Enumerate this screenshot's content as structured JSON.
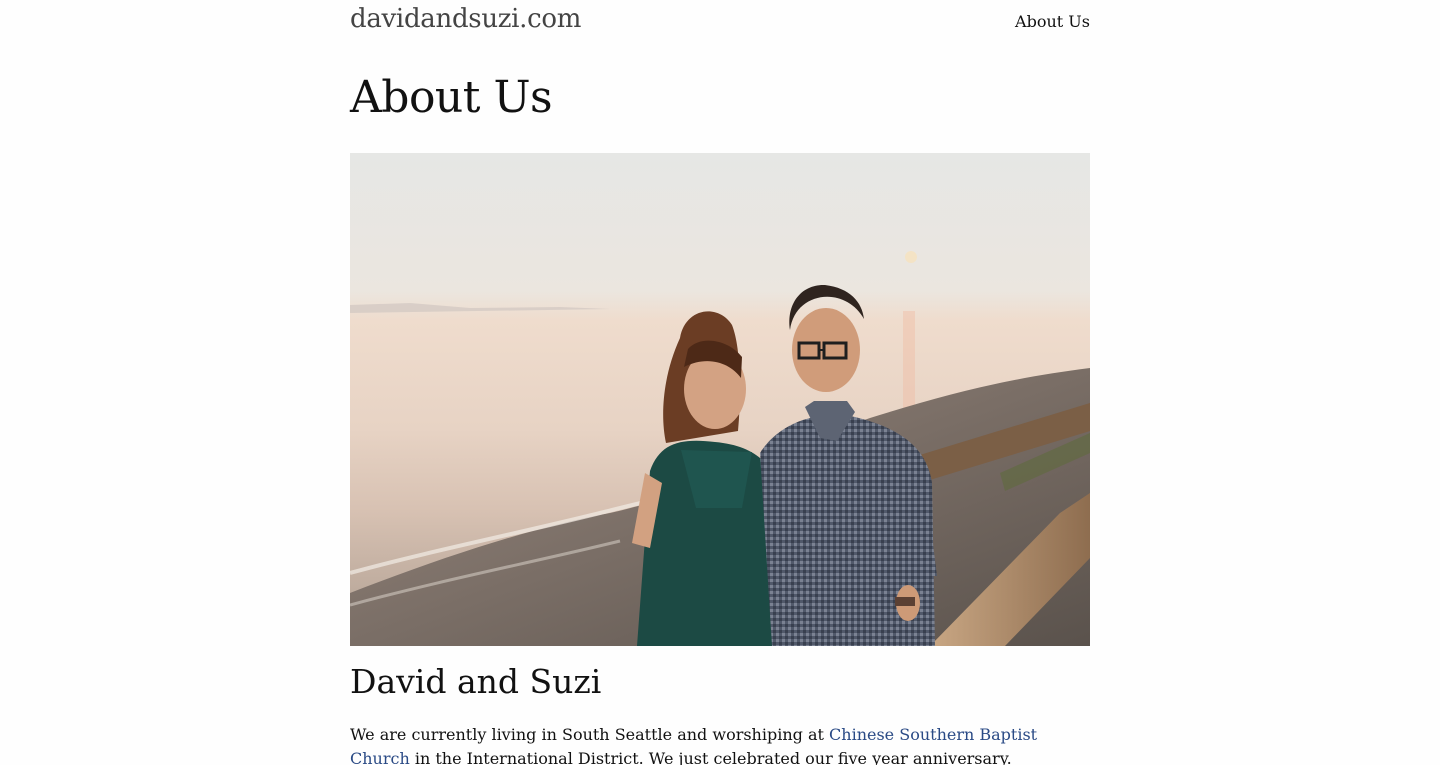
{
  "site": {
    "title": "davidandsuzi.com"
  },
  "nav": {
    "items": [
      {
        "label": "About Us"
      }
    ]
  },
  "page": {
    "title": "About Us",
    "section_title": "David and Suzi",
    "intro": {
      "before_link": "We are currently living in South Seattle and worshiping at ",
      "link_text": "Chinese Southern Baptist Church",
      "after_link": " in the International District. We just celebrated our five year anniversary. Throughout the week,"
    }
  },
  "colors": {
    "link": "#2a4a85",
    "title": "#444444",
    "text": "#111111"
  }
}
